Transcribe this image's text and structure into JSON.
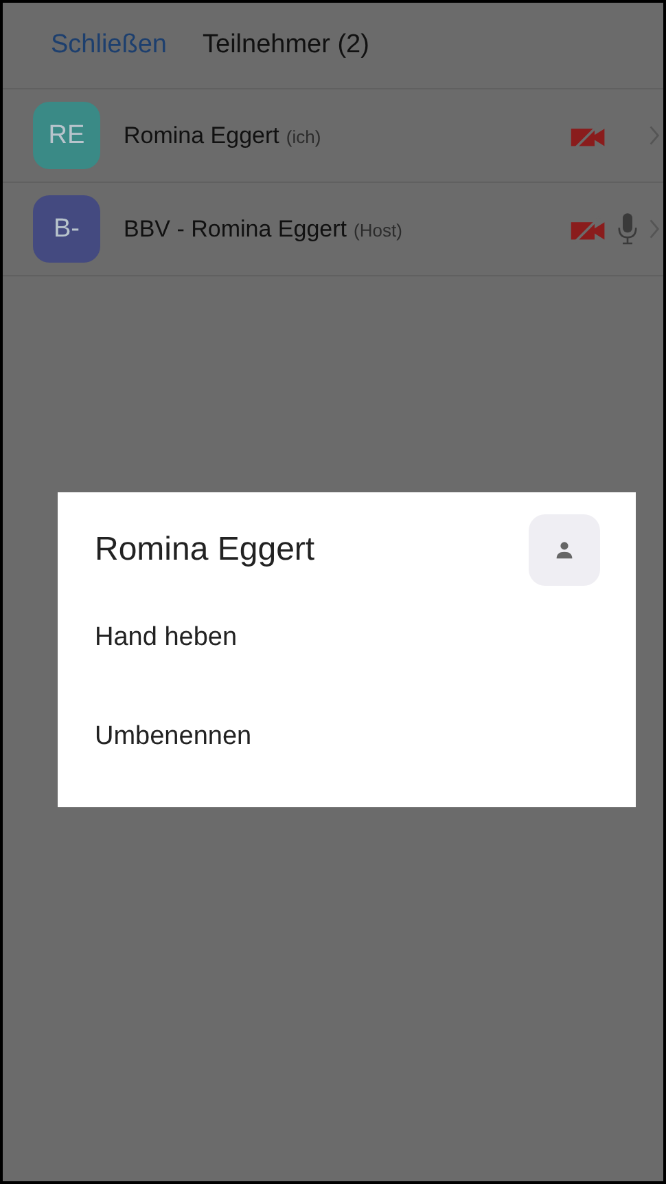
{
  "header": {
    "close": "Schließen",
    "title": "Teilnehmer (2)"
  },
  "participants": [
    {
      "initials": "RE",
      "color": "#3a8a86",
      "name": "Romina Eggert",
      "tag": "(ich)",
      "video_muted": true,
      "mic_shown": false
    },
    {
      "initials": "B-",
      "color": "#444a80",
      "name": "BBV - Romina Eggert",
      "tag": "(Host)",
      "video_muted": true,
      "mic_shown": true
    }
  ],
  "dialog": {
    "title": "Romina Eggert",
    "items": [
      "Hand heben",
      "Umbenennen"
    ]
  }
}
